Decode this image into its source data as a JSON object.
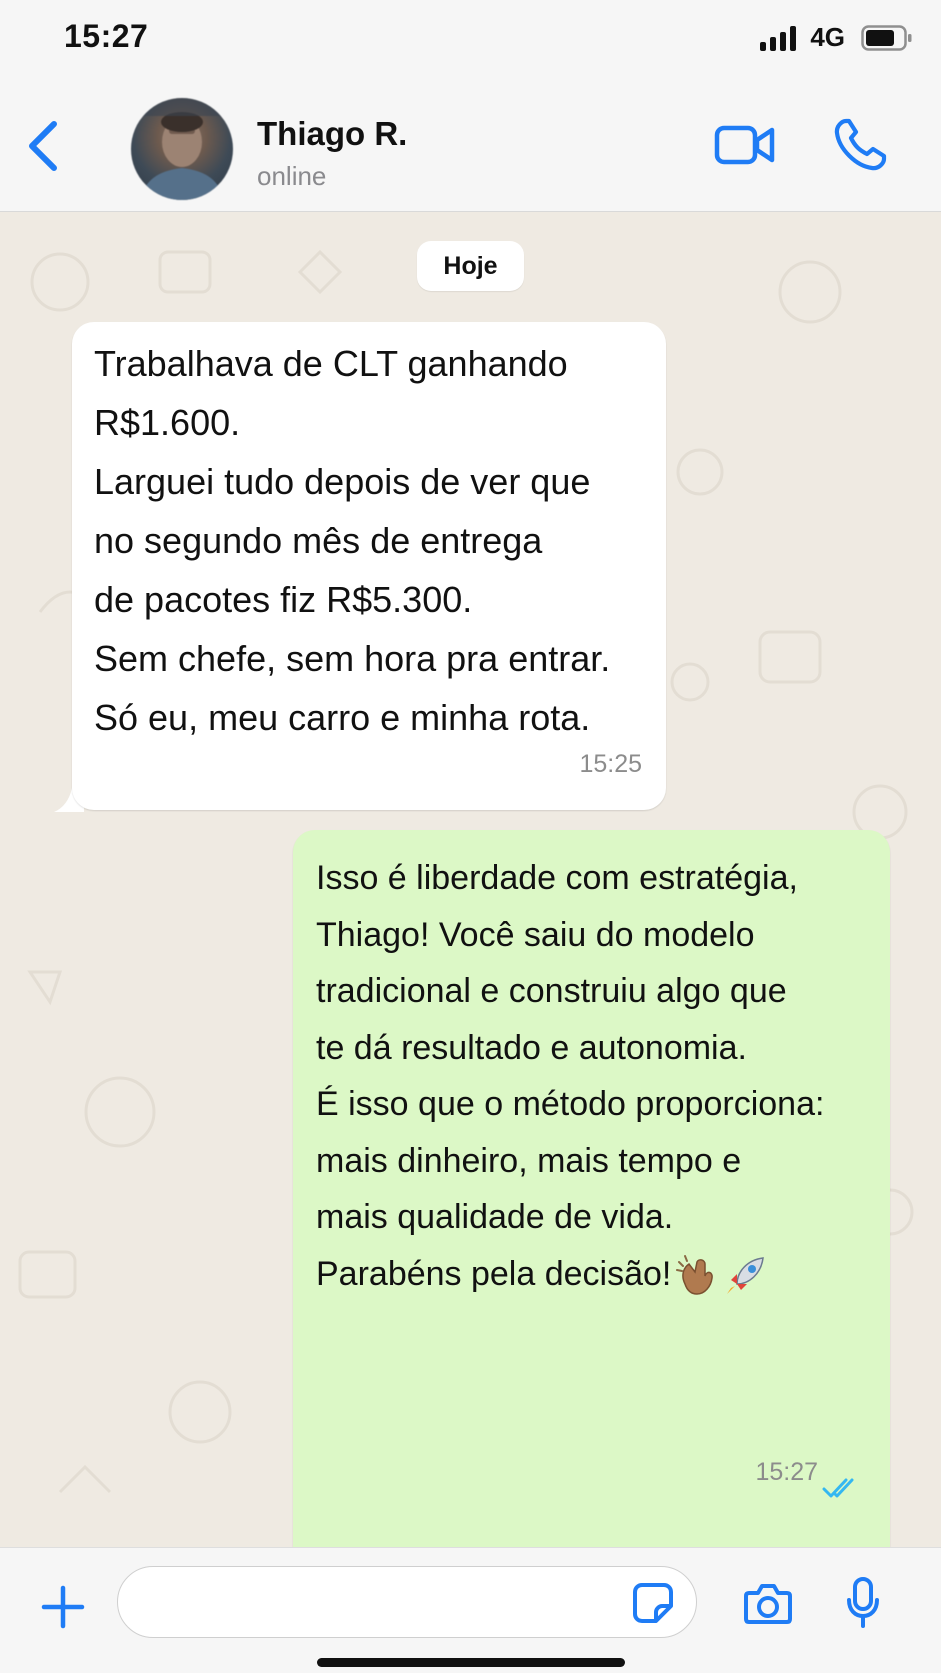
{
  "status_bar": {
    "time": "15:27",
    "network": "4G"
  },
  "header": {
    "contact_name": "Thiago R.",
    "contact_status": "online",
    "back_icon": "chevron-left-icon",
    "video_icon": "video-camera-icon",
    "call_icon": "phone-icon"
  },
  "chat": {
    "date_label": "Hoje",
    "messages": [
      {
        "direction": "incoming",
        "lines": [
          "Trabalhava de CLT ganhando",
          "R$1.600.",
          "Larguei tudo depois de ver que",
          "no segundo mês de entrega",
          "de pacotes fiz R$5.300.",
          "Sem chefe, sem hora pra entrar.",
          "Só eu, meu carro e minha rota."
        ],
        "time": "15:25"
      },
      {
        "direction": "outgoing",
        "lines": [
          "Isso é liberdade com estratégia,",
          "Thiago! Você saiu do modelo",
          "tradicional e construiu algo que",
          "te dá resultado e autonomia.",
          "É isso que o método proporciona:",
          "mais dinheiro, mais tempo e",
          "mais qualidade de vida.",
          "Parabéns pela decisão!"
        ],
        "emojis": [
          "clapping-hands-emoji",
          "rocket-emoji"
        ],
        "time": "15:27",
        "read_status": "read"
      }
    ]
  },
  "input_bar": {
    "placeholder": "",
    "value": ""
  },
  "colors": {
    "accent_blue": "#1f7cf5",
    "outgoing_bubble": "#dcf8c6",
    "incoming_bubble": "#ffffff",
    "chat_background": "#efeae2",
    "read_receipt": "#34b7f1"
  }
}
